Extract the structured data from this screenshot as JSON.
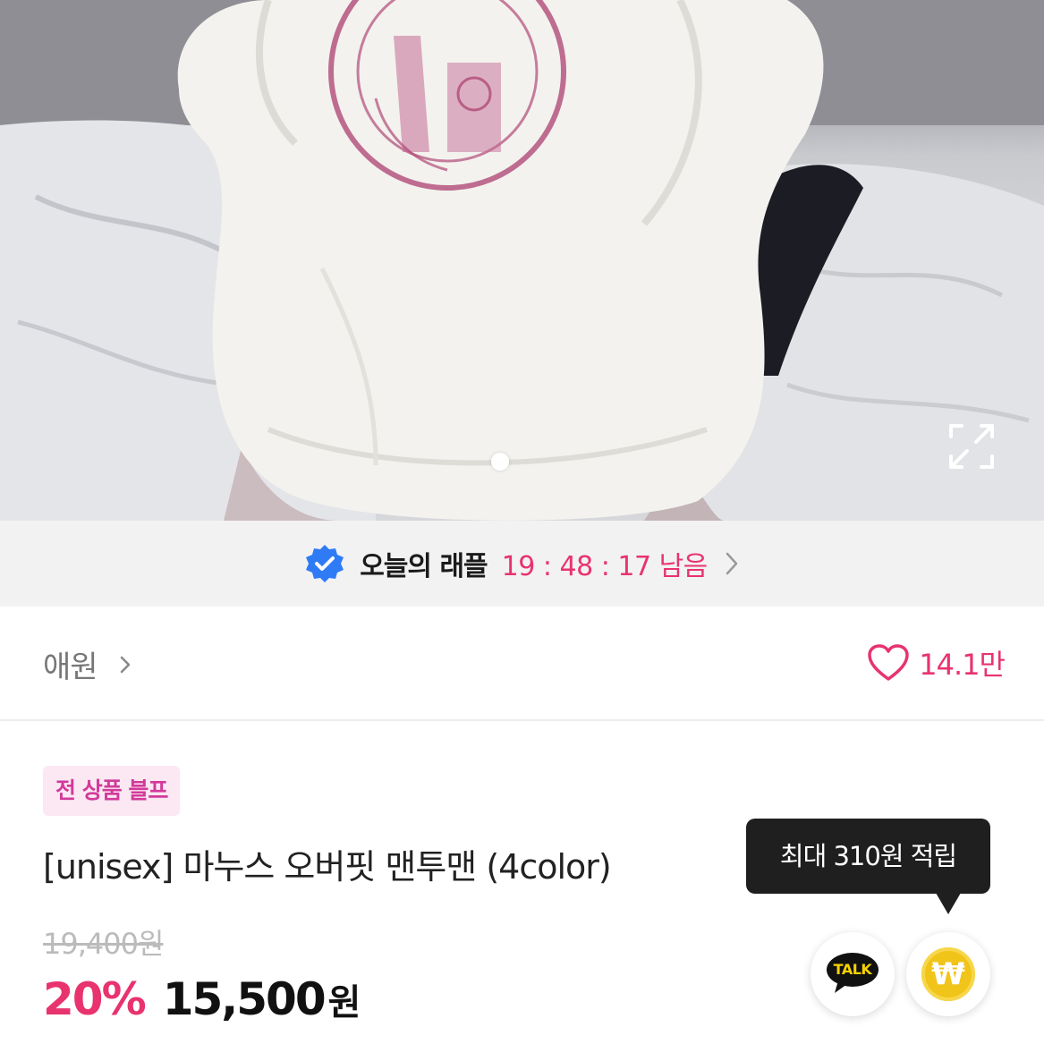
{
  "product_image": {
    "expand_icon": "expand-arrows-icon",
    "carousel_index": 1
  },
  "raffle": {
    "badge_icon": "verified-badge-icon",
    "label": "오늘의 래플",
    "timer": "19 : 48 : 17 남음",
    "chevron_icon": "chevron-right-icon",
    "accent_color": "#e8336f"
  },
  "store": {
    "name": "애원",
    "chevron_icon": "chevron-right-icon",
    "like_icon": "heart-outline-icon",
    "like_count": "14.1만"
  },
  "product": {
    "tag": "전 상품 블프",
    "title": "[unisex] 마누스 오버핏 맨투맨 (4color)",
    "original_price": "19,400원",
    "discount": "20%",
    "price": "15,500",
    "price_unit": "원"
  },
  "reward_tooltip": {
    "text": "최대 310원 적립"
  },
  "actions": {
    "talk_label": "TALK",
    "talk_icon": "kakaotalk-icon",
    "point_symbol": "₩",
    "point_icon": "won-coin-icon"
  }
}
